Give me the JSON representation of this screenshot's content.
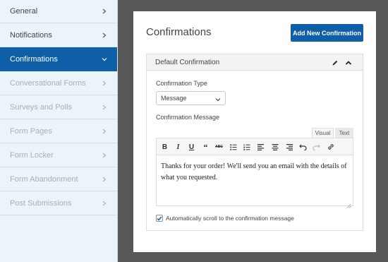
{
  "sidebar": {
    "items": [
      {
        "label": "General",
        "state": "normal"
      },
      {
        "label": "Notifications",
        "state": "normal"
      },
      {
        "label": "Confirmations",
        "state": "active"
      },
      {
        "label": "Conversational Forms",
        "state": "disabled"
      },
      {
        "label": "Surveys and Polls",
        "state": "disabled"
      },
      {
        "label": "Form Pages",
        "state": "disabled"
      },
      {
        "label": "Form Locker",
        "state": "disabled"
      },
      {
        "label": "Form Abandonment",
        "state": "disabled"
      },
      {
        "label": "Post Submissions",
        "state": "disabled"
      }
    ]
  },
  "panel": {
    "title": "Confirmations",
    "add_button_label": "Add New Confirmation",
    "box": {
      "title": "Default Confirmation",
      "type_label": "Confirmation Type",
      "type_value": "Message",
      "message_label": "Confirmation Message",
      "tabs": {
        "visual": "Visual",
        "text": "Text"
      },
      "message_text": "Thanks for your order! We'll send you an email with the details of what you requested.",
      "toolbar": [
        "bold-icon",
        "italic-icon",
        "underline-icon",
        "blockquote-icon",
        "strikethrough-icon",
        "bullet-list-icon",
        "numbered-list-icon",
        "align-left-icon",
        "align-center-icon",
        "align-right-icon",
        "undo-icon",
        "redo-icon",
        "link-icon"
      ],
      "checkbox_label": "Automatically scroll to the confirmation message",
      "checkbox_checked": true
    }
  },
  "colors": {
    "accent": "#0e5fa8",
    "backdrop": "#58585a",
    "sidebar_bg": "#ebf3fb",
    "disabled_text": "#a7b0b9"
  }
}
